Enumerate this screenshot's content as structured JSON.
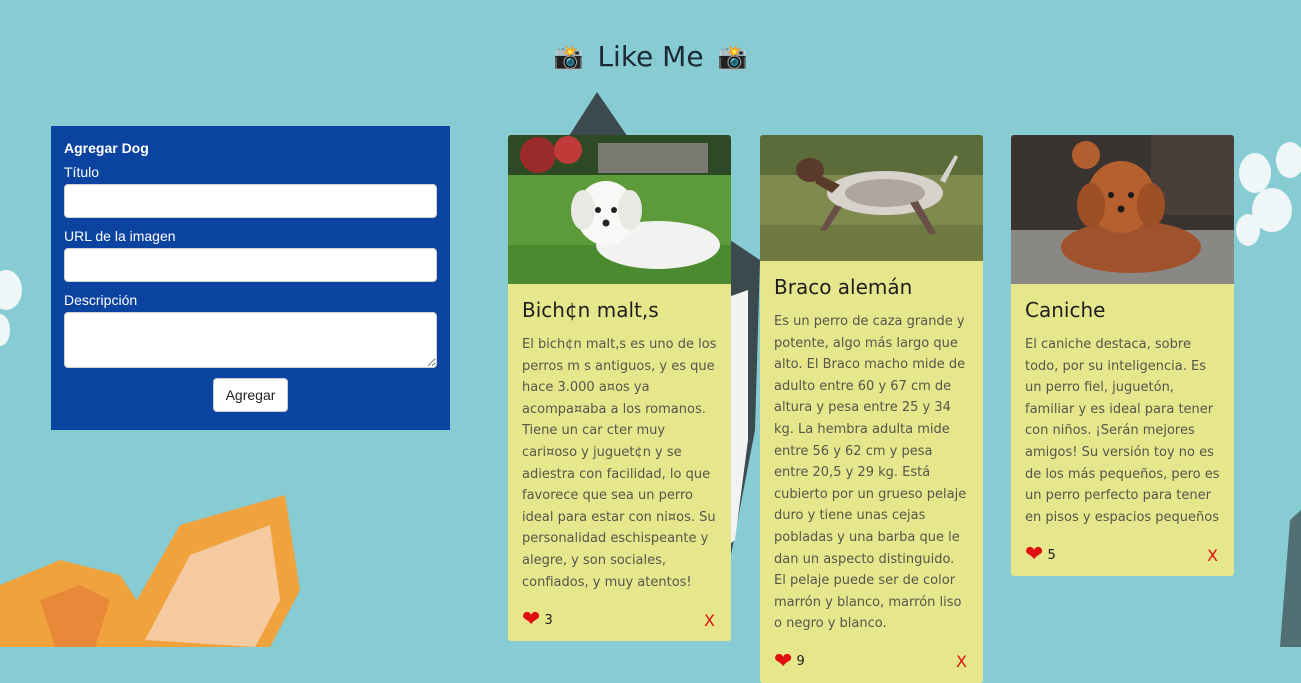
{
  "header": {
    "title": "Like Me",
    "icon_left": "📸",
    "icon_right": "📸"
  },
  "form": {
    "heading": "Agregar Dog",
    "title_label": "Título",
    "title_value": "",
    "url_label": "URL de la imagen",
    "url_value": "",
    "description_label": "Descripción",
    "description_value": "",
    "submit_label": "Agregar"
  },
  "posts": [
    {
      "title": "Bich¢n malt,s",
      "description": "El bich¢n malt,s es uno de los perros m s antiguos, y es que hace 3.000 a¤os ya acompa¤aba a los romanos. Tiene un car cter muy cari¤oso y juguet¢n y se adiestra con facilidad, lo que favorece que sea un perro ideal para estar con ni¤os. Su personalidad eschispeante y alegre, y son sociales, confiados, y muy atentos!",
      "likes": "3",
      "delete_label": "X"
    },
    {
      "title": "Braco alemán",
      "description": "Es un perro de caza grande y potente, algo más largo que alto. El Braco macho mide de adulto entre 60 y 67 cm de altura y pesa entre 25 y 34 kg. La hembra adulta mide entre 56 y 62 cm y pesa entre 20,5 y 29 kg. Está cubierto por un grueso pelaje duro y tiene unas cejas pobladas y una barba que le dan un aspecto distinguido. El pelaje puede ser de color marrón y blanco, marrón liso o negro y blanco.",
      "likes": "9",
      "delete_label": "X"
    },
    {
      "title": "Caniche",
      "description": "El caniche destaca, sobre todo, por su inteligencia. Es un perro fiel, juguetón, familiar y es ideal para tener con niños. ¡Serán mejores amigos! Su versión toy no es de los más pequeños, pero es un perro perfecto para tener en pisos y espacios pequeños",
      "likes": "5",
      "delete_label": "X"
    }
  ],
  "icons": {
    "header": "camera-flash-icon",
    "like": "heart-icon",
    "delete": "close-icon"
  },
  "colors": {
    "background": "#87cbd3",
    "form_panel": "#0b44a0",
    "card": "#e6e68c",
    "like_heart": "#e01010",
    "delete": "#e01010"
  }
}
